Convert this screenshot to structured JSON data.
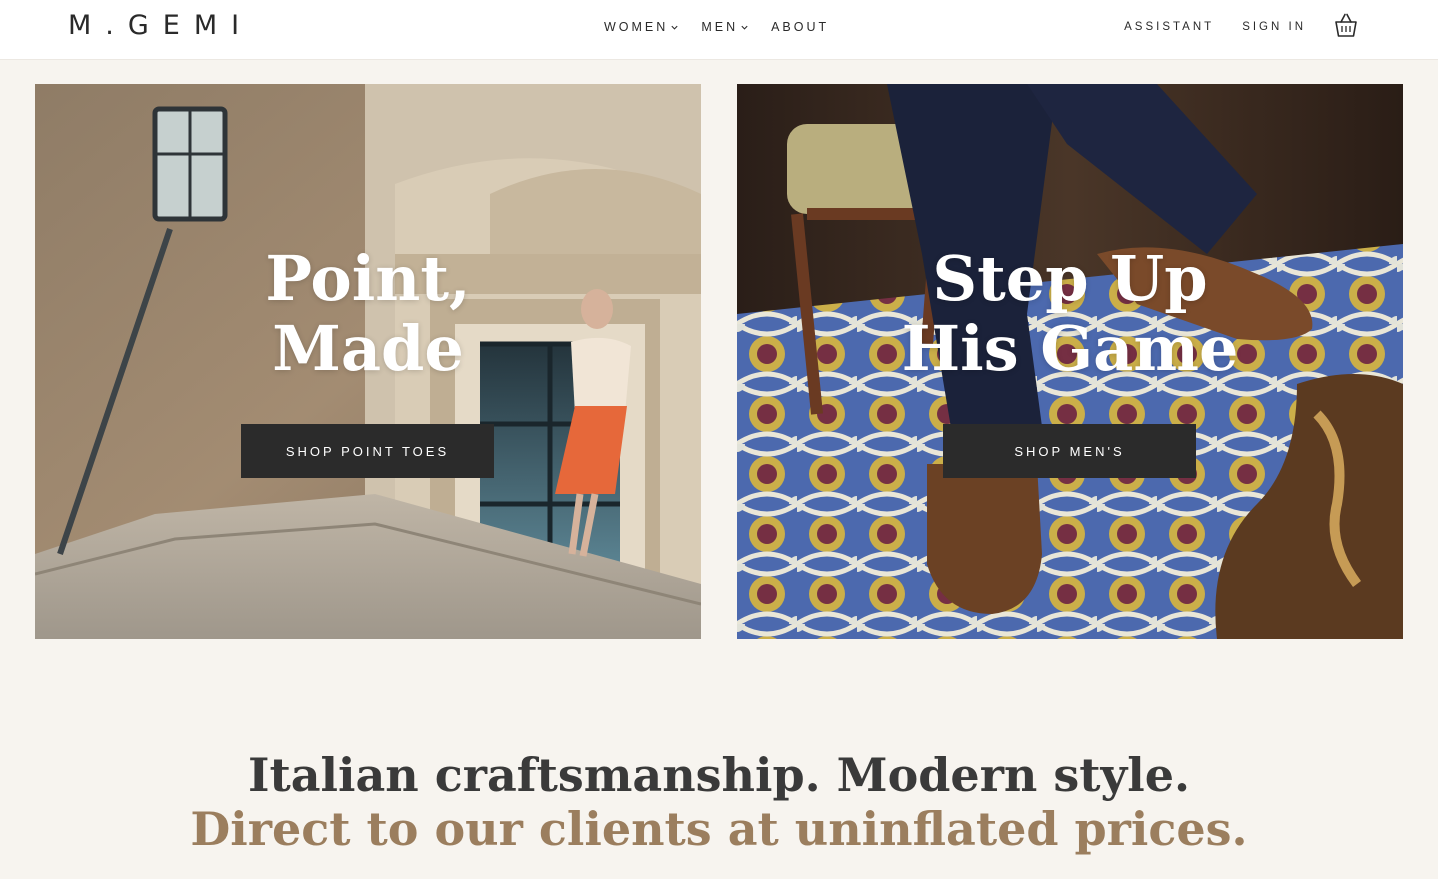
{
  "header": {
    "logo": "M.GEMI",
    "nav": [
      {
        "label": "WOMEN",
        "has_dropdown": true
      },
      {
        "label": "MEN",
        "has_dropdown": true
      },
      {
        "label": "ABOUT",
        "has_dropdown": false
      }
    ],
    "assistant_label": "ASSISTANT",
    "sign_in_label": "SIGN IN",
    "cart_icon": "shopping-bag-icon"
  },
  "hero": {
    "left": {
      "headline_line1": "Point,",
      "headline_line2": "Made",
      "cta_label": "SHOP POINT TOES"
    },
    "right": {
      "headline_line1": "Step Up",
      "headline_line2": "His Game",
      "cta_label": "SHOP MEN'S"
    }
  },
  "tagline": {
    "line1": "Italian craftsmanship. Modern style.",
    "line2": "Direct to our clients at uninflated prices."
  },
  "colors": {
    "page_bg": "#f7f4ef",
    "header_bg": "#ffffff",
    "cta_bg": "#2b2b2b",
    "tagline_dark": "#3a3a3a",
    "tagline_accent": "#9b7e5e"
  }
}
